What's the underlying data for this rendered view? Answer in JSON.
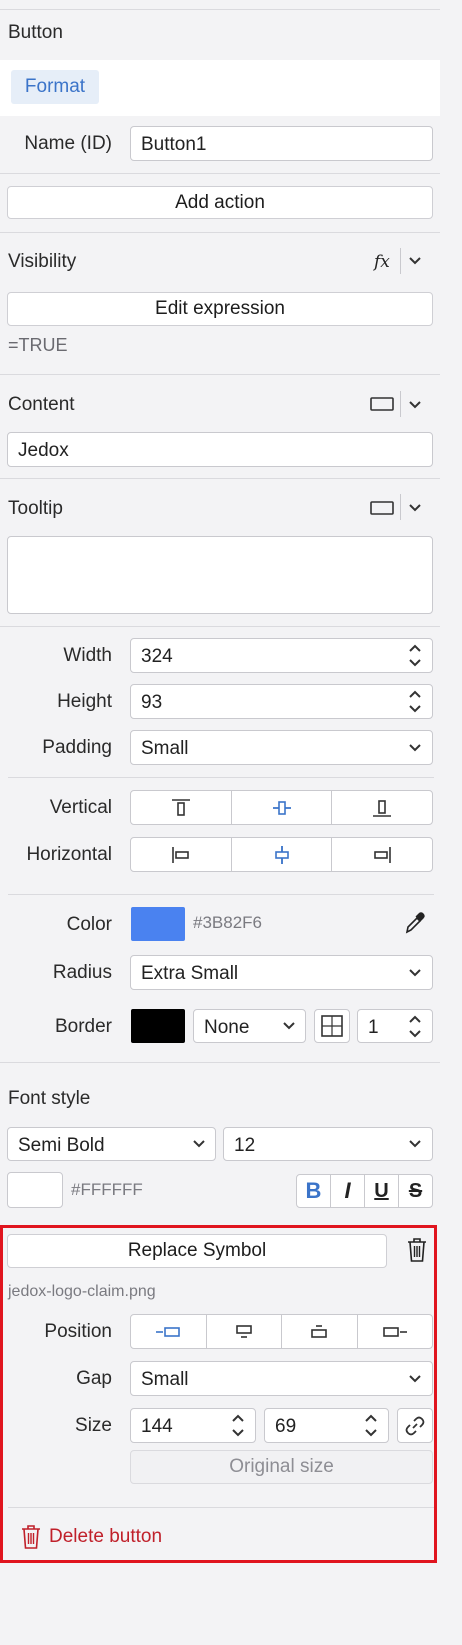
{
  "component": {
    "type_label": "Button",
    "tab_format": "Format"
  },
  "name_id": {
    "label": "Name (ID)",
    "value": "Button1"
  },
  "add_action_label": "Add action",
  "visibility": {
    "title": "Visibility",
    "fx": "fx",
    "edit_label": "Edit expression",
    "expression": "=TRUE"
  },
  "content": {
    "title": "Content",
    "value": "Jedox"
  },
  "tooltip": {
    "title": "Tooltip",
    "value": ""
  },
  "layout": {
    "width_label": "Width",
    "width_value": "324",
    "height_label": "Height",
    "height_value": "93",
    "padding_label": "Padding",
    "padding_value": "Small"
  },
  "alignment": {
    "vertical_label": "Vertical",
    "horizontal_label": "Horizontal"
  },
  "appearance": {
    "color_label": "Color",
    "color_hex": "#3B82F6",
    "radius_label": "Radius",
    "radius_value": "Extra Small",
    "border_label": "Border",
    "border_color": "#000000",
    "border_style": "None",
    "border_width": "1"
  },
  "font": {
    "title": "Font style",
    "weight": "Semi Bold",
    "size": "12",
    "color_hex": "#FFFFFF",
    "bold": "B",
    "italic": "I",
    "underline": "U",
    "strike": "S"
  },
  "symbol": {
    "replace_label": "Replace Symbol",
    "file_name": "jedox-logo-claim.png",
    "position_label": "Position",
    "gap_label": "Gap",
    "gap_value": "Small",
    "size_label": "Size",
    "size_w": "144",
    "size_h": "69",
    "original_size_label": "Original size"
  },
  "delete_label": "Delete button",
  "colors": {
    "accent": "#3b74c9",
    "tab_bg": "#e6eef8",
    "danger": "#c0202a",
    "highlight": "#e0141e"
  }
}
